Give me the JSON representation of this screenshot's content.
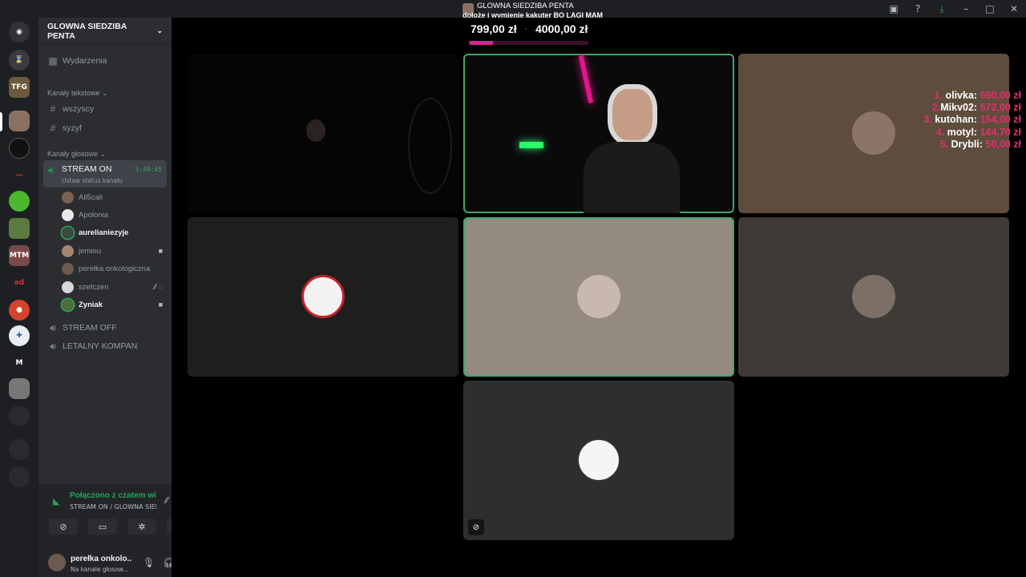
{
  "titlebar": {
    "title": "GLOWNA SIEDZIBA PENTA",
    "subtitle": "dołożę i wymienię kąkuter BO LAGI MAM",
    "icons": [
      "inbox-icon",
      "help-icon",
      "download-icon",
      "minimize-icon",
      "maximize-icon",
      "close-icon"
    ]
  },
  "donation": {
    "current": "799,00 zł",
    "separator": "·",
    "goal": "4000,00 zł",
    "progress": 0.2,
    "bar_color": "#d4278d"
  },
  "guild": {
    "name": "GLOWNA SIEDZIBA PENTA",
    "events": "Wydarzenia",
    "text_category": "Kanały tekstowe",
    "text_channels": [
      "wszyscy",
      "syzyf"
    ],
    "voice_category": "Kanały głosowe",
    "active_voice": {
      "name": "STREAM ON",
      "status": "Ustaw status kanału",
      "timer": "3:48:45"
    },
    "voice_users": [
      {
        "name": "Ali5cali",
        "bright": false,
        "speaking": false,
        "color": "#7a6250",
        "icons": ""
      },
      {
        "name": "Apolonia",
        "bright": false,
        "speaking": false,
        "color": "#e8e8e8",
        "icons": ""
      },
      {
        "name": "aurelianiezyje",
        "bright": true,
        "speaking": true,
        "color": "#3d4a3e",
        "icons": ""
      },
      {
        "name": "jemiou",
        "bright": false,
        "speaking": false,
        "color": "#a88570",
        "icons": "■"
      },
      {
        "name": "perełka onkologiczna",
        "bright": false,
        "speaking": false,
        "color": "#6c5a4e",
        "icons": ""
      },
      {
        "name": "szefczen",
        "bright": false,
        "speaking": false,
        "color": "#d8d8d8",
        "icons": "⁄⁄ ◌"
      },
      {
        "name": "Zyniak",
        "bright": true,
        "speaking": true,
        "color": "#4b6d3f",
        "icons": "■"
      }
    ],
    "other_voice": [
      "STREAM OFF",
      "LETALNY KOMPAN"
    ]
  },
  "voice_panel": {
    "connected": "Połączono z czatem wid",
    "channel": "STREAM ON / GLOWNA SIED..."
  },
  "user_panel": {
    "name": "perełka onkolo...",
    "status": "Na kanale głosow..."
  },
  "leaderboard": [
    {
      "rank": "1.",
      "name": "olivka:",
      "amount": "690,00 zł"
    },
    {
      "rank": "2.",
      "name": "Mikv02:",
      "amount": "572,00 zł"
    },
    {
      "rank": "3.",
      "name": "kutohan:",
      "amount": "154,00 zł"
    },
    {
      "rank": "4.",
      "name": "motyl:",
      "amount": "144,70 zł"
    },
    {
      "rank": "5.",
      "name": "Drybli:",
      "amount": "50,00 zł"
    }
  ],
  "colors": {
    "accent_green": "#23a55a",
    "pink": "#e1306c"
  }
}
